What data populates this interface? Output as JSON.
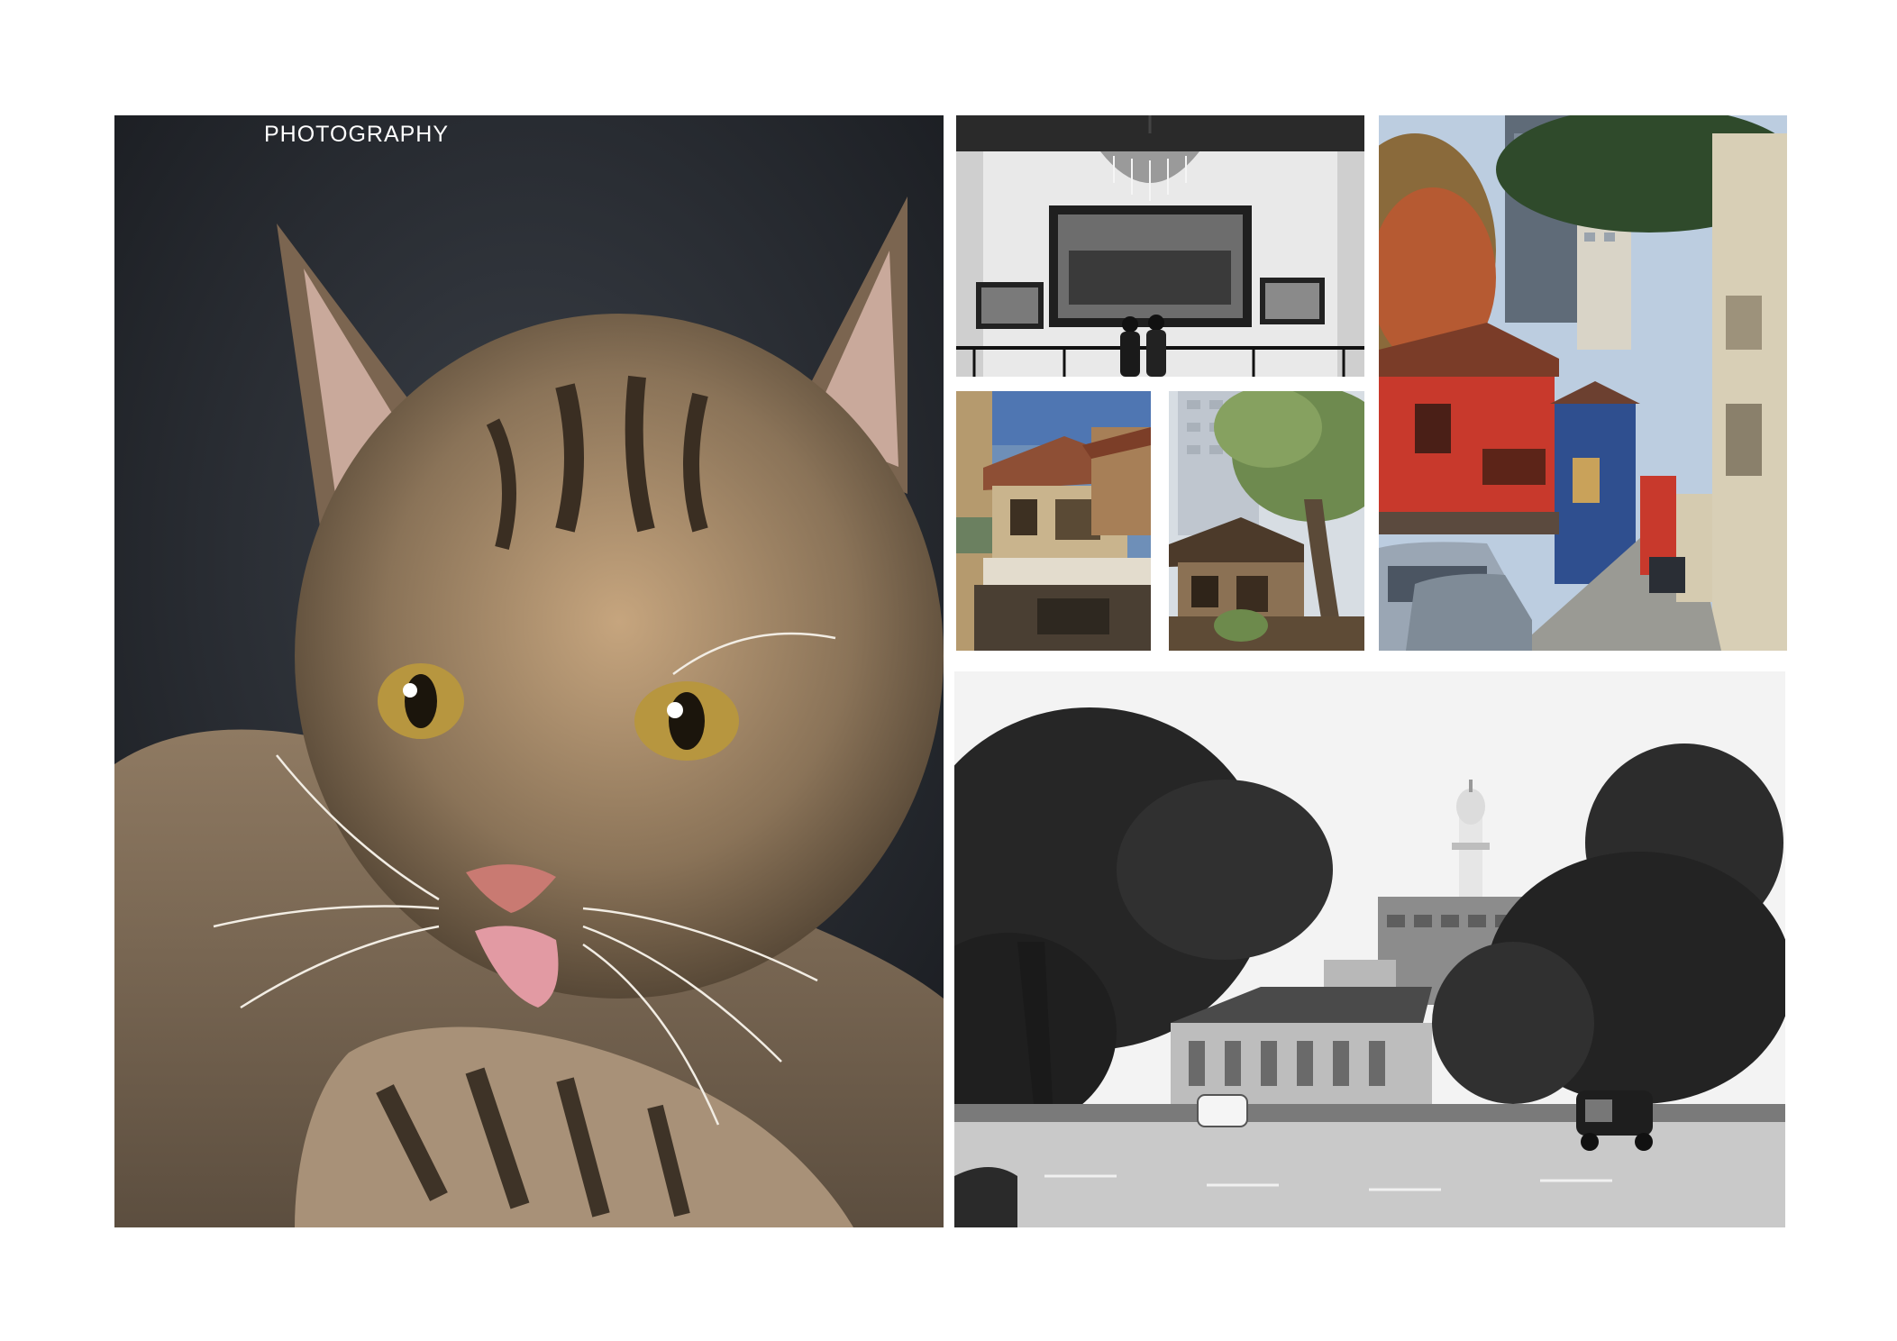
{
  "page": {
    "title": "PHOTOGRAPHY"
  },
  "photos": [
    {
      "subject": "kitten-icon"
    },
    {
      "subject": "museum-hall-icon"
    },
    {
      "subject": "tiled-roof-houses-icon"
    },
    {
      "subject": "tree-houses-icon"
    },
    {
      "subject": "colorful-street-icon"
    },
    {
      "subject": "city-square-mosque-icon"
    }
  ],
  "colors": {
    "background": "#ffffff",
    "title_text": "#ffffff",
    "kitten_fur": "#8a7358",
    "red_house": "#c8392c",
    "blue_house": "#2f4f8f"
  }
}
